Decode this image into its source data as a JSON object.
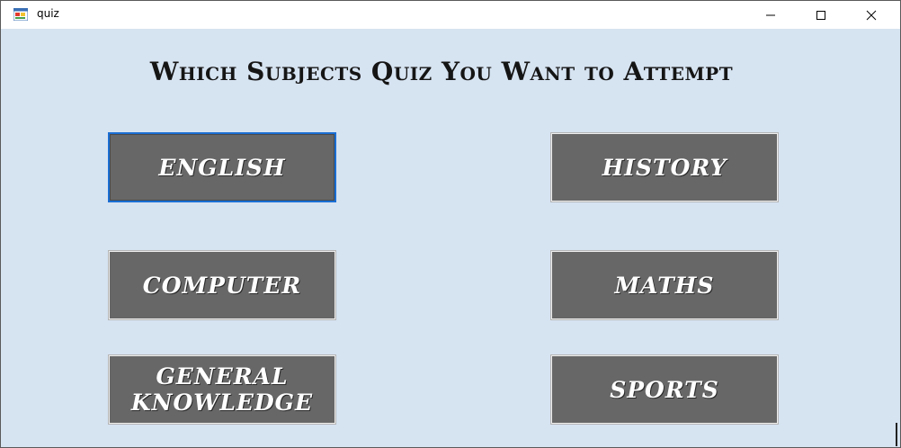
{
  "window": {
    "title": "quiz",
    "icons": {
      "app": "form-app-icon",
      "minimize": "minimize-icon",
      "maximize": "maximize-icon",
      "close": "close-icon"
    }
  },
  "main": {
    "heading": "Which Subjects Quiz You Want to Attempt"
  },
  "subjects": {
    "english": "ENGLISH",
    "history": "HISTORY",
    "computer": "COMPUTER",
    "maths": "MATHS",
    "general_knowledge": "GENERAL\nKNOWLEDGE",
    "sports": "SPORTS"
  },
  "colors": {
    "background": "#d6e3f1",
    "button": "#676767",
    "focus_border": "#1a6ed3"
  }
}
